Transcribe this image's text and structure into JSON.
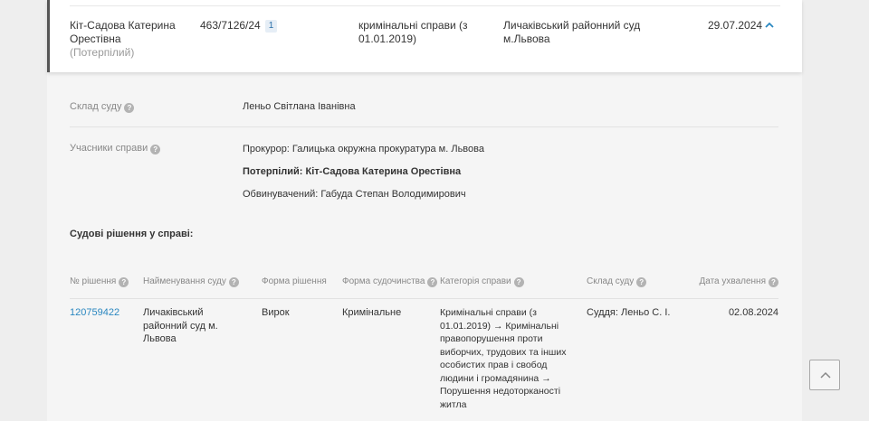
{
  "case": {
    "party_name": "Кіт-Садова Катерина Орестівна",
    "party_role": "(Потерпілий)",
    "case_number": "463/7126/24",
    "case_badge": "1",
    "case_category": "кримінальні справи (з 01.01.2019)",
    "court": "Личаківський районний суд м.Львова",
    "date": "29.07.2024"
  },
  "details": {
    "composition_label": "Склад суду",
    "composition_value": "Леньо Світлана Іванівна",
    "participants_label": "Учасники справи",
    "participants": [
      "Прокурор: Галицька окружна прокуратура м. Львова",
      "Потерпілий: Кіт-Садова Катерина Орестівна",
      "Обвинувачений: Габуда Степан Володимирович"
    ]
  },
  "decisions": {
    "title": "Судові рішення у справі:",
    "headers": [
      "№ рішення",
      "Найменування суду",
      "Форма рішення",
      "Форма судочинства",
      "Категорія справи",
      "Склад суду",
      "Дата ухвалення"
    ],
    "rows": [
      {
        "number": "120759422",
        "court": "Личаківський районний суд м. Львова",
        "form": "Вирок",
        "proceeding": "Кримінальне",
        "category": "Кримінальні справи (з 01.01.2019) → Кримінальні правопорушення проти виборчих, трудових та інших особистих прав і свобод людини і громадянина → Порушення недоторканості житла",
        "composition": "Суддя: Леньо С. І.",
        "date": "02.08.2024"
      }
    ]
  },
  "colors": {
    "link": "#2a87c0",
    "accent_border": "#555555",
    "badge_bg": "#e6eef6"
  },
  "icons": {
    "expand": "chevron-up-icon",
    "help": "question-circle-icon",
    "scroll_top": "arrow-up-icon"
  }
}
